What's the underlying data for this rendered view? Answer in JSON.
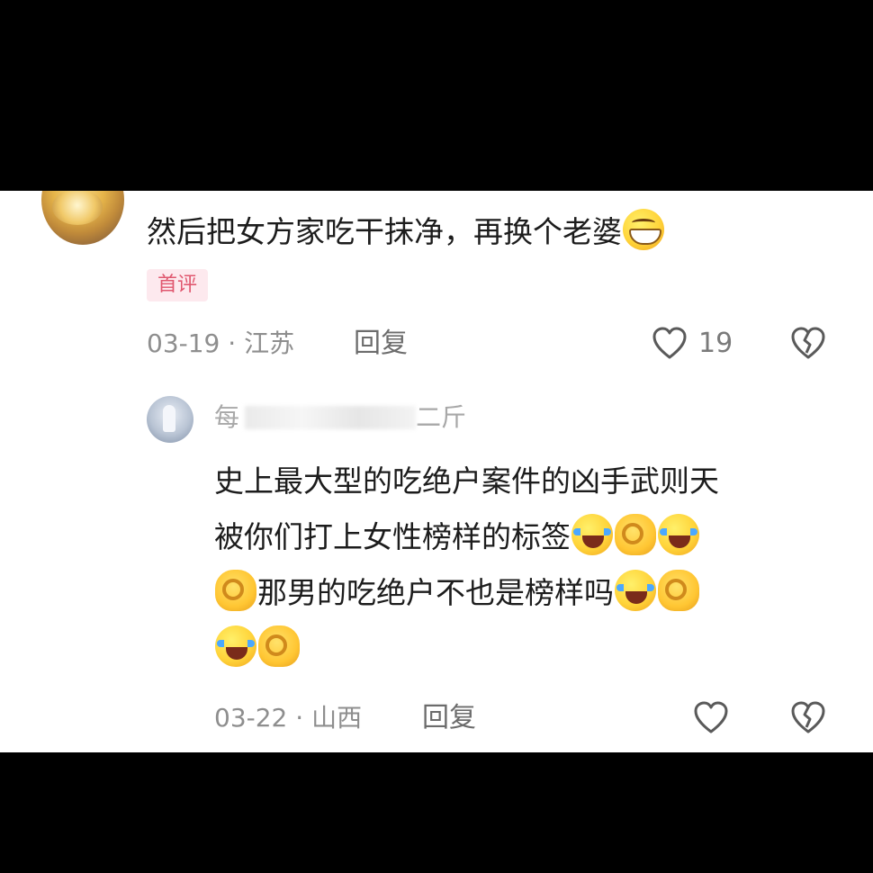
{
  "comment1": {
    "text": "然后把女方家吃干抹净，再换个老婆",
    "emoji": "grinning-face",
    "badge": "首评",
    "date": "03-19",
    "location": "江苏",
    "reply_label": "回复",
    "like_count": "19"
  },
  "comment2": {
    "username_visible": "每",
    "username_tail": "二斤",
    "lines": [
      "史上最大型的吃绝户案件的凶手武则天",
      "被你们打上女性榜样的标签",
      "那男的吃绝户不也是榜样吗"
    ],
    "emojis": [
      "face-with-tears-of-joy",
      "ok-hand",
      "face-with-tears-of-joy",
      "ok-hand",
      "face-with-tears-of-joy",
      "ok-hand",
      "face-with-tears-of-joy",
      "ok-hand"
    ],
    "date": "03-22",
    "location": "山西",
    "reply_label": "回复"
  },
  "colors": {
    "background": "#000000",
    "card": "#ffffff",
    "badge_bg": "#fde9ee",
    "badge_text": "#e0576f",
    "meta_text": "#8e8e8e"
  },
  "icons": [
    "heart-outline-icon",
    "broken-heart-icon"
  ]
}
